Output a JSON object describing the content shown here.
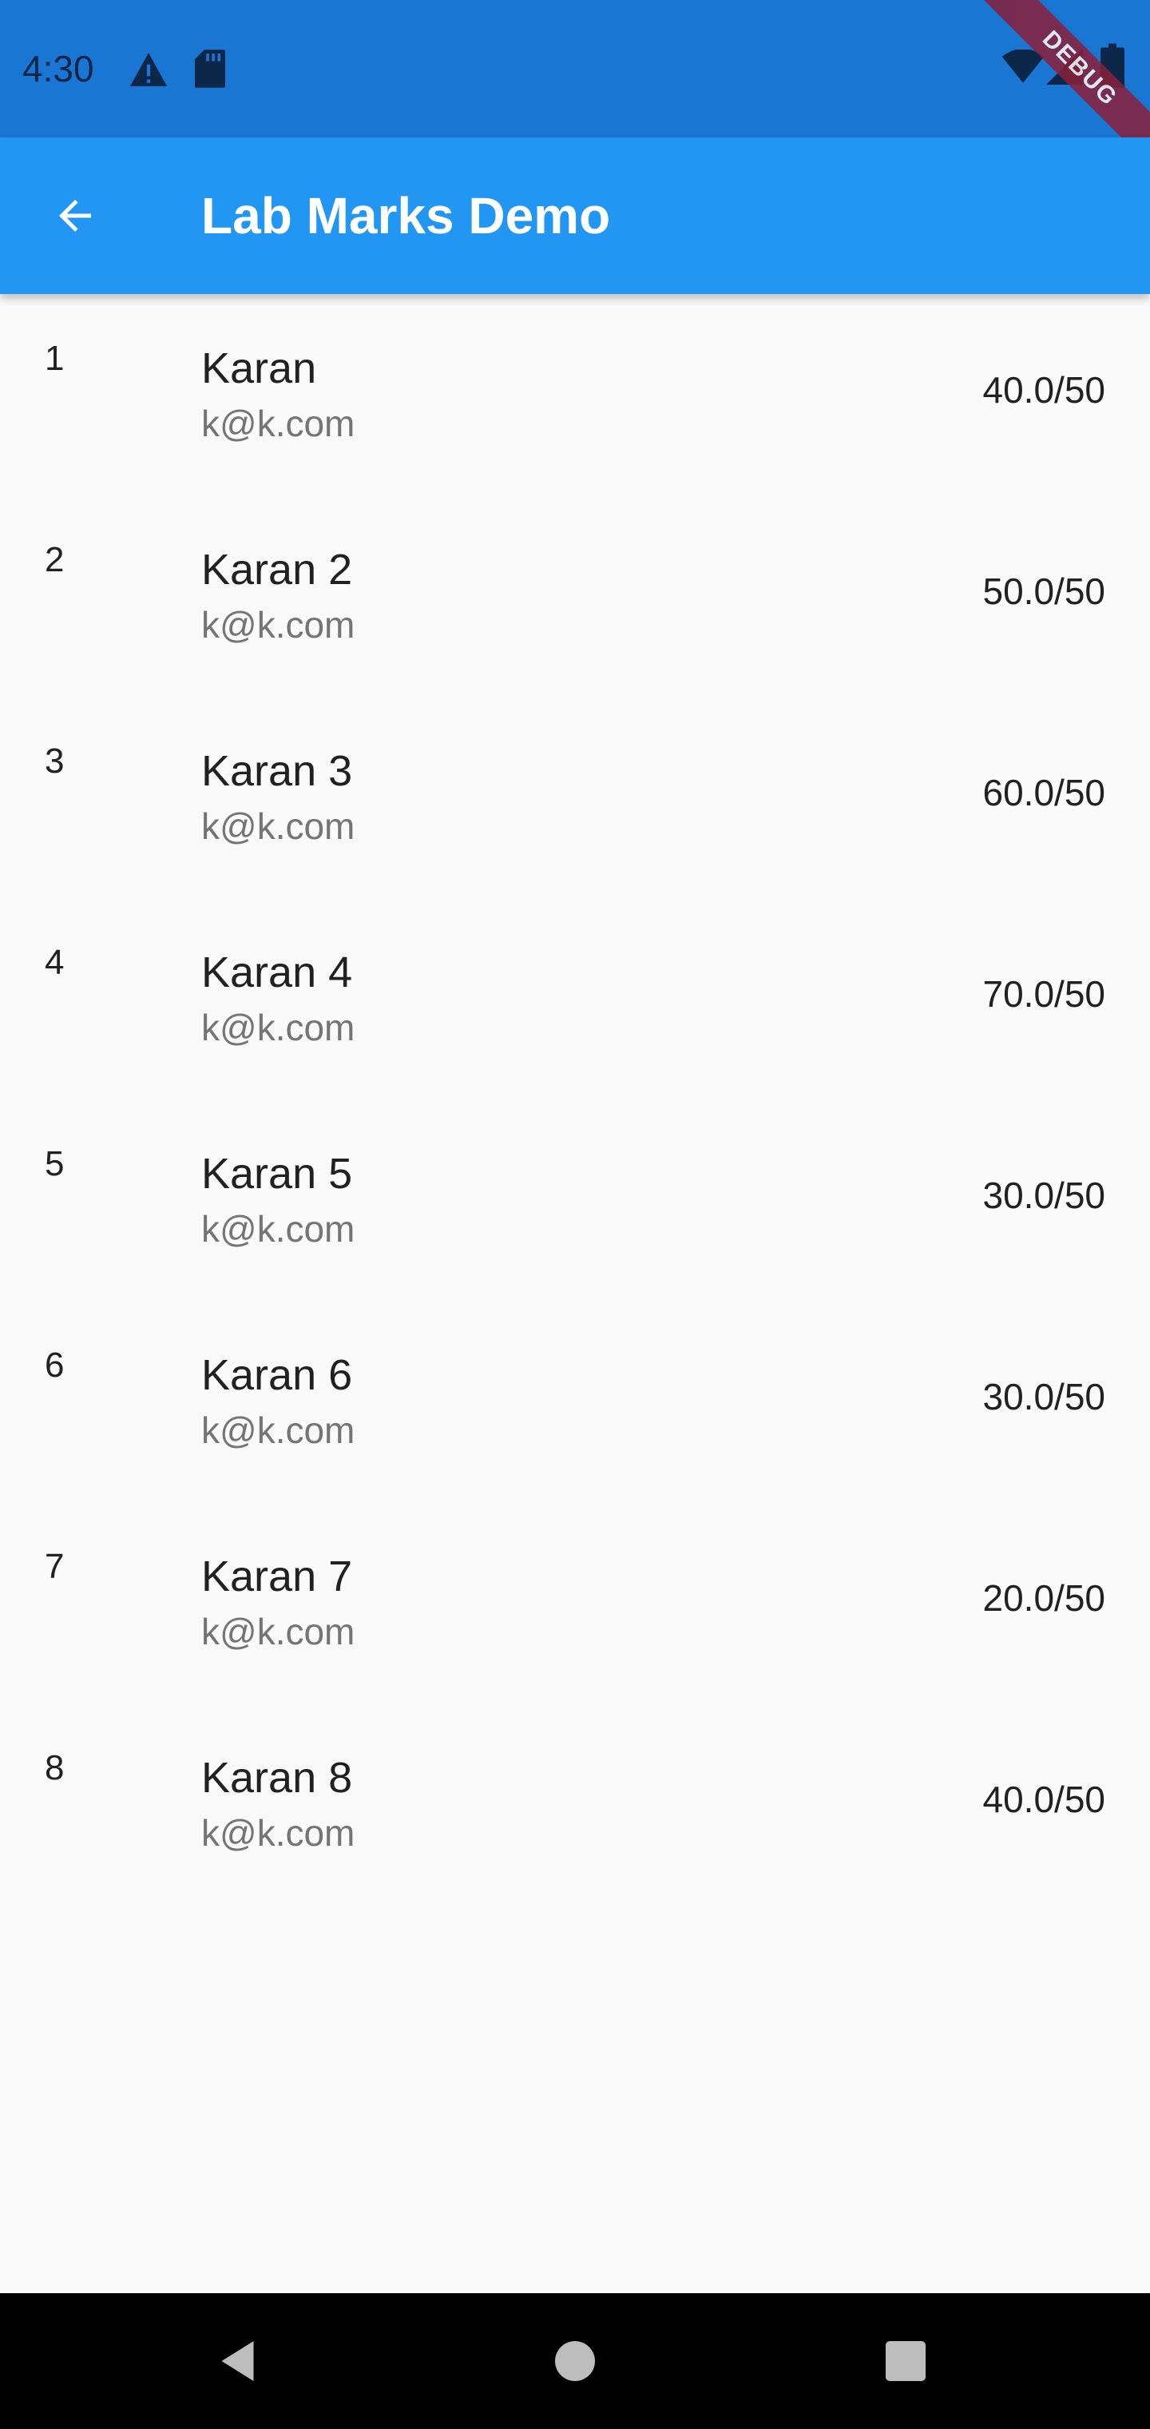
{
  "status_bar": {
    "time": "4:30",
    "debug_label": "DEBUG",
    "icons": [
      "warning-icon",
      "sd-card-icon",
      "wifi-icon",
      "signal-icon",
      "battery-icon"
    ]
  },
  "app_bar": {
    "title": "Lab Marks Demo",
    "back_icon": "arrow-back-icon"
  },
  "students": [
    {
      "index": "1",
      "name": "Karan",
      "email": "k@k.com",
      "marks": "40.0/50"
    },
    {
      "index": "2",
      "name": "Karan 2",
      "email": "k@k.com",
      "marks": "50.0/50"
    },
    {
      "index": "3",
      "name": "Karan 3",
      "email": "k@k.com",
      "marks": "60.0/50"
    },
    {
      "index": "4",
      "name": "Karan 4",
      "email": "k@k.com",
      "marks": "70.0/50"
    },
    {
      "index": "5",
      "name": "Karan 5",
      "email": "k@k.com",
      "marks": "30.0/50"
    },
    {
      "index": "6",
      "name": "Karan 6",
      "email": "k@k.com",
      "marks": "30.0/50"
    },
    {
      "index": "7",
      "name": "Karan 7",
      "email": "k@k.com",
      "marks": "20.0/50"
    },
    {
      "index": "8",
      "name": "Karan 8",
      "email": "k@k.com",
      "marks": "40.0/50"
    }
  ],
  "nav_bar": {
    "buttons": [
      "back-triangle-icon",
      "home-circle-icon",
      "recents-square-icon"
    ]
  },
  "colors": {
    "status_bar": "#1976d2",
    "app_bar": "#2196f3",
    "background": "#fafafa",
    "primary_text": "#212121",
    "secondary_text": "#757575",
    "debug_banner": "#8a1f3a"
  }
}
